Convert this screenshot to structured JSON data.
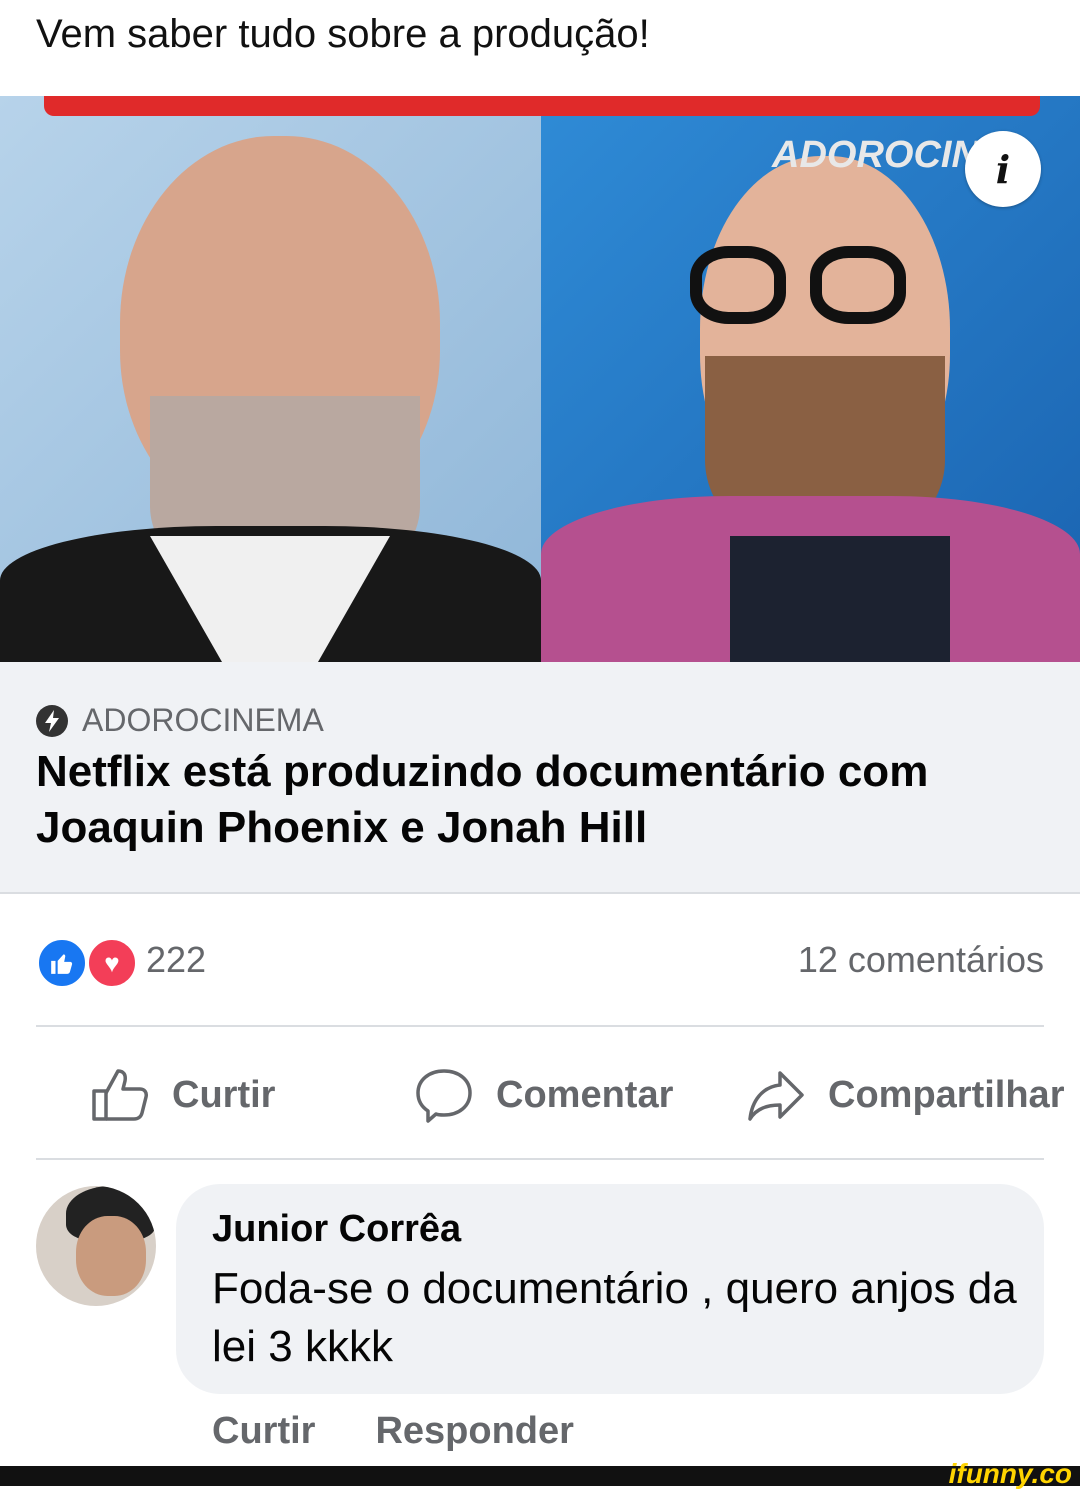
{
  "post": {
    "caption": "Vem saber tudo sobre a produção!"
  },
  "image": {
    "watermark": "ADOROCIN",
    "info_icon": "i"
  },
  "link": {
    "source": "ADOROCINEMA",
    "headline": "Netflix está produzindo documentário com Joaquin Phoenix e Jonah Hill"
  },
  "stats": {
    "reactions": "222",
    "comments": "12 comentários"
  },
  "actions": {
    "like": "Curtir",
    "comment": "Comentar",
    "share": "Compartilhar"
  },
  "comment": {
    "author": "Junior Corrêa",
    "text": "Foda-se o documentário , quero anjos da lei 3 kkkk",
    "like": "Curtir",
    "reply": "Responder"
  },
  "brand": {
    "watermark": "ifunny.co"
  },
  "colors": {
    "like_blue": "#1877f2",
    "love_red": "#f33e58",
    "muted_text": "#65676b",
    "card_bg": "#f0f2f5"
  }
}
